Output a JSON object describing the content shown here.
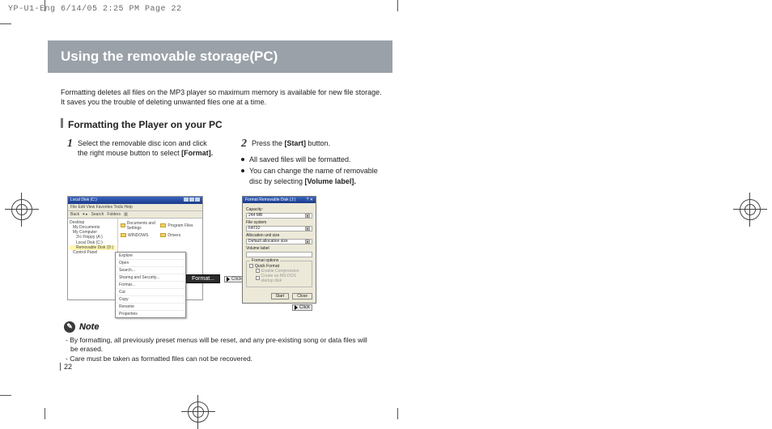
{
  "header": "YP-U1-Eng  6/14/05 2:25 PM  Page 22",
  "title": "Using the removable storage(PC)",
  "intro_line1": "Formatting deletes all files on the MP3 player so maximum memory is available for new file storage.",
  "intro_line2": "It saves you the trouble of deleting unwanted files one at a time.",
  "section_title": "Formatting the Player on your PC",
  "steps": [
    {
      "num": "1",
      "text_pre": "Select the removable disc icon and click the right mouse button to select ",
      "text_bold": "[Format].",
      "bullets": []
    },
    {
      "num": "2",
      "text_pre": "Press the ",
      "text_bold": "[Start]",
      "text_post": " button.",
      "bullets": [
        "All saved files will be formatted.",
        "You can change the name of removable disc by selecting [Volume label]."
      ]
    }
  ],
  "explorer": {
    "title": "Local Disk (C:)",
    "menu": "File  Edit  View  Favorites  Tools  Help",
    "toolbar_back": "Back",
    "toolbar_search": "Search",
    "toolbar_folders": "Folders",
    "tree": [
      "Desktop",
      "My Documents",
      "My Computer",
      "3½ Floppy (A:)",
      "Local Disk (C:)",
      "Removable Disk (D:)",
      "Control Panel"
    ],
    "folders": [
      "Documents and Settings",
      "Program Files",
      "WINDOWS",
      "Drivers"
    ],
    "context_menu": [
      "Explore",
      "Open",
      "Search...",
      "Sharing and Security...",
      "Format...",
      "Cut",
      "Copy",
      "Rename",
      "Properties"
    ],
    "format_flyout": "Format...",
    "click_badge": "Click"
  },
  "dialog": {
    "title": "Format Removable Disk (J:)",
    "capacity_label": "Capacity:",
    "capacity_value": "244 MB",
    "fs_label": "File system",
    "fs_value": "FAT32",
    "alloc_label": "Allocation unit size",
    "alloc_value": "Default allocation size",
    "vol_label": "Volume label",
    "group_legend": "Format options",
    "quick": "Quick Format",
    "compress": "Enable Compression",
    "msdos": "Create an MS-DOS startup disk",
    "start": "Start",
    "close": "Close",
    "click_badge": "Click"
  },
  "note": {
    "icon": "✎",
    "label": "Note",
    "items": [
      "- By formatting, all previously preset menus will be reset, and any pre-existing song or data files will be erased.",
      "- Care must be taken as formatted files can not be recovered."
    ]
  },
  "page_number": "22"
}
